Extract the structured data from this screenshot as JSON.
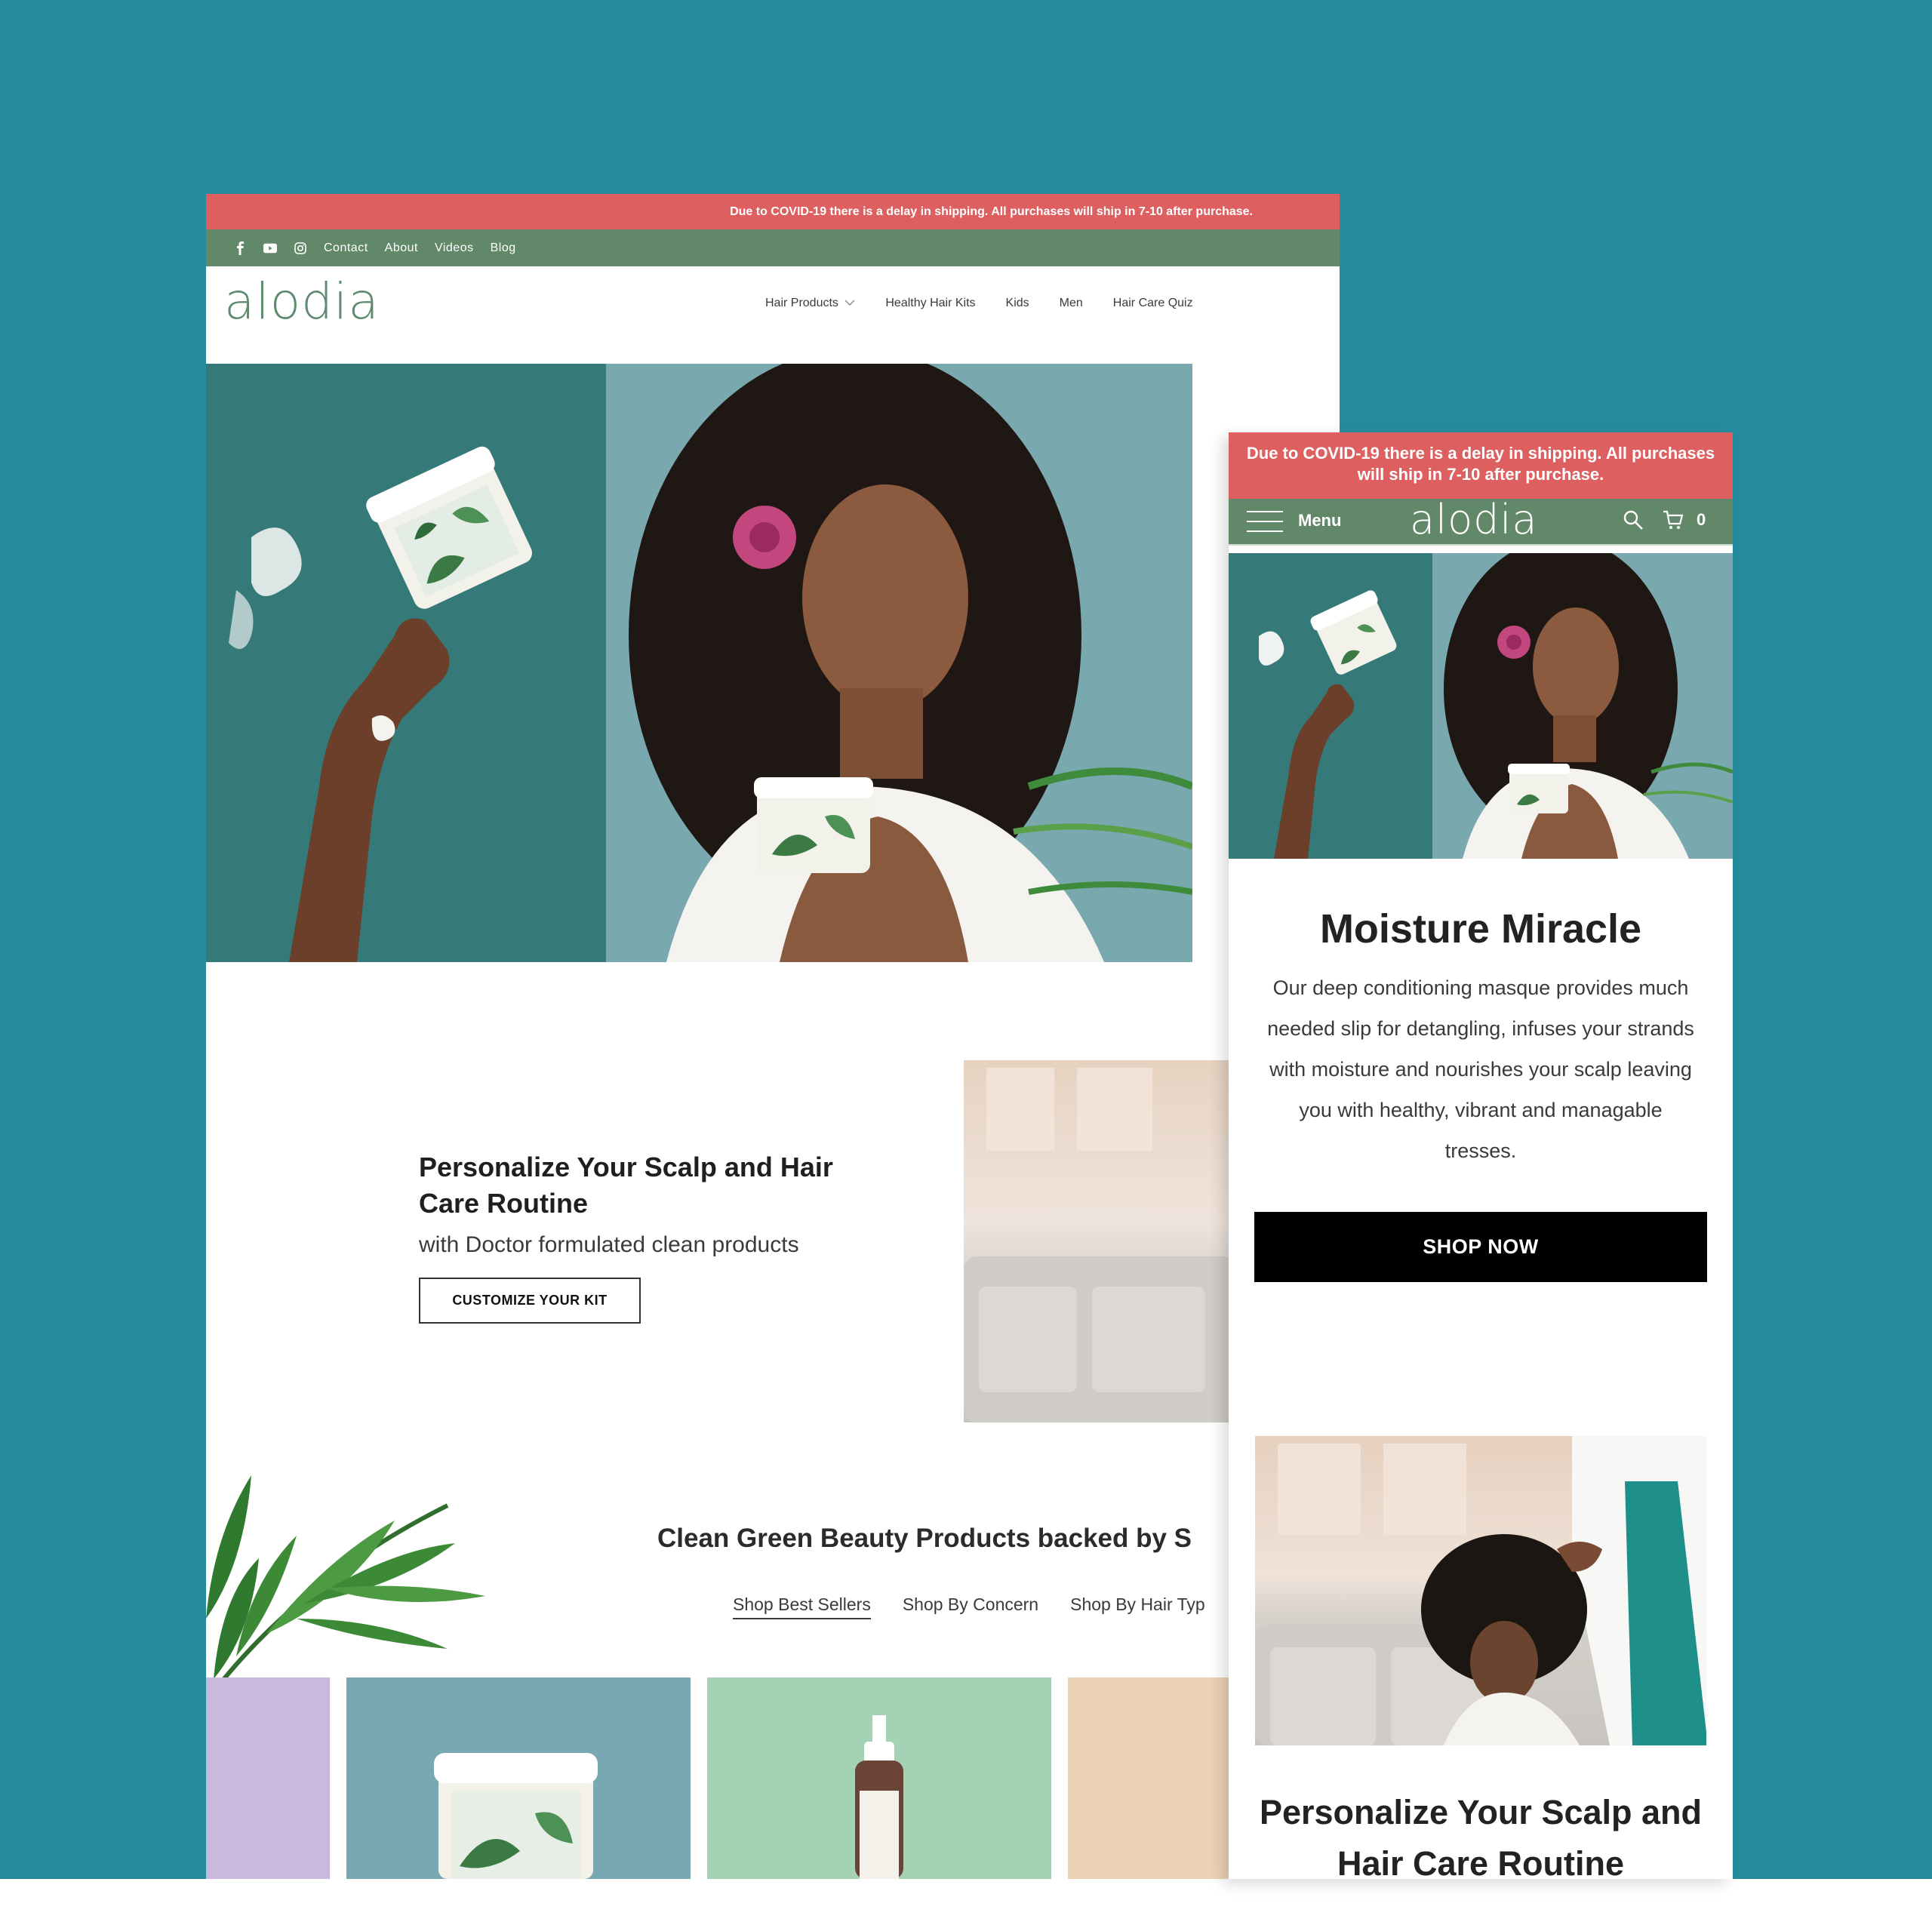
{
  "desktop": {
    "covid_banner": "Due to COVID-19 there is a delay in shipping. All purchases will ship in 7-10 after purchase.",
    "utility_links": [
      "Contact",
      "About",
      "Videos",
      "Blog"
    ],
    "social_icons": [
      "facebook-icon",
      "youtube-icon",
      "instagram-icon"
    ],
    "logo": "alodia",
    "nav": [
      "Hair Products",
      "Healthy Hair Kits",
      "Kids",
      "Men",
      "Hair Care Quiz"
    ],
    "personalize": {
      "title": "Personalize Your Scalp and Hair Care Routine",
      "subtitle": "with Doctor formulated clean products",
      "button": "CUSTOMIZE YOUR KIT"
    },
    "clean_heading": "Clean Green Beauty Products backed by S",
    "tabs": [
      "Shop Best Sellers",
      "Shop By Concern",
      "Shop By Hair Typ"
    ]
  },
  "mobile": {
    "covid_banner": "Due to COVID-19 there is a delay in shipping. All purchases will ship in 7-10 after purchase.",
    "menu_label": "Menu",
    "logo": "alodia",
    "cart_count": "0",
    "headline": "Moisture Miracle",
    "description": "Our deep conditioning masque provides much needed slip for detangling, infuses your strands with moisture and nourishes your scalp leaving you with healthy, vibrant and managable tresses.",
    "cta": "SHOP NOW",
    "bottom_heading": "Personalize Your Scalp and Hair Care Routine"
  },
  "colors": {
    "background": "#268c9d",
    "banner_red": "#de5f5f",
    "brand_green": "#62886a",
    "logo_green": "#5c8b6e",
    "tile_lavender": "#c9b9dd",
    "tile_blue": "#79a8b3",
    "tile_mint": "#a5d1b5",
    "tile_peach": "#ebd2b4"
  }
}
